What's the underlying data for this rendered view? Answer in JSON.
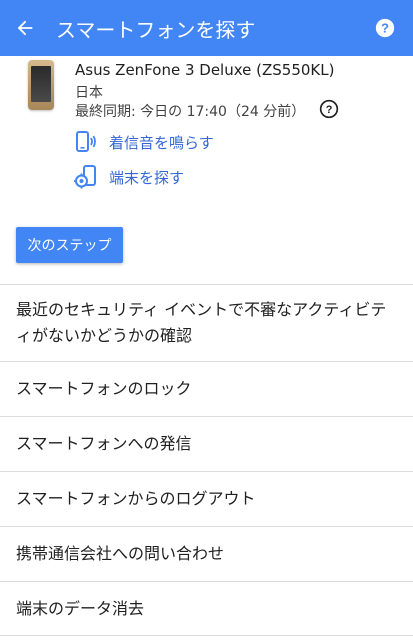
{
  "header": {
    "title": "スマートフォンを探す",
    "back_icon": "arrow-back-icon",
    "help_icon": "help-circle-icon",
    "bar_color": "#4285f4"
  },
  "device": {
    "name": "Asus ZenFone 3 Deluxe (ZS550KL)",
    "country": "日本",
    "last_sync": "最終同期: 今日の 17:40（24 分前）",
    "sync_help_icon": "help-outline-icon"
  },
  "actions": [
    {
      "label": "着信音を鳴らす",
      "icon": "phone-ring-icon"
    },
    {
      "label": "端末を探す",
      "icon": "locate-device-icon"
    }
  ],
  "next_button": {
    "label": "次のステップ"
  },
  "steps": [
    {
      "label": "最近のセキュリティ イベントで不審なアクティビティがないかどうかの確認"
    },
    {
      "label": "スマートフォンのロック"
    },
    {
      "label": "スマートフォンへの発信"
    },
    {
      "label": "スマートフォンからのログアウト"
    },
    {
      "label": "携帯通信会社への問い合わせ"
    },
    {
      "label": "端末のデータ消去"
    }
  ],
  "colors": {
    "accent": "#4285f4",
    "link": "#3367d6"
  }
}
